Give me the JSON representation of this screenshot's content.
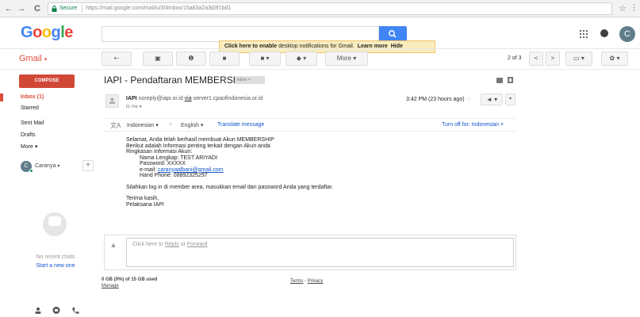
{
  "browser": {
    "back": "←",
    "forward": "→",
    "reload": "C",
    "secure_label": "Secure",
    "url": "https://mail.google.com/mail/u/3/#inbox/15a83a2a3d3f1bd1",
    "star": "☆",
    "menu": "⋮"
  },
  "header": {
    "logo_letters": [
      "G",
      "o",
      "o",
      "g",
      "l",
      "e"
    ],
    "notice_link": "Click here to enable",
    "notice_text": " desktop notifications for Gmail.",
    "notice_learn": "Learn more",
    "notice_hide": "Hide",
    "avatar_letter": "C"
  },
  "gmail_label": "Gmail",
  "gmail_caret": "▾",
  "toolbar": {
    "back": "⇠",
    "archive": "▣",
    "spam": "❶",
    "delete": "■",
    "move": "■ ▾",
    "labels": "◆ ▾",
    "more": "More ▾",
    "pager": "2 of 3",
    "prev": "<",
    "next": ">",
    "view": "▭ ▾",
    "settings": "✿ ▾"
  },
  "sidebar": {
    "compose": "COMPOSE",
    "items": [
      {
        "label": "Inbox (1)"
      },
      {
        "label": "Starred"
      },
      {
        "label": "Sent Mail"
      },
      {
        "label": "Drafts"
      },
      {
        "label": "More ▾"
      }
    ],
    "chat_user": "Caranya",
    "chat_user_caret": "▾",
    "chat_initial": "C",
    "chat_add": "+",
    "no_chats": "No recent chats",
    "start_new": "Start a new one"
  },
  "message": {
    "subject": "IAPI - Pendaftaran MEMBERSHIP",
    "label_chip": "Inbox ×",
    "sender_name": "IAPI",
    "sender_addr": "noreply@iapi.or.id",
    "via_word": "via",
    "via_server": "server1.cpaofindonesia.or.id",
    "to_me": "to me ▾",
    "time": "3:42 PM (23 hours ago)",
    "star": "☆",
    "reply": "◄ ▾",
    "more": "▾"
  },
  "translate": {
    "from_lang": "Indonesian ▾",
    "arrow": ">",
    "to_lang": "English ▾",
    "translate_link": "Translate message",
    "turn_off": "Turn off for: Indonesian ×"
  },
  "body_lines": {
    "l1": "Selamat, Anda telah berhasil membuat Akun MEMBERSHIP",
    "l2": "Berikut adalah Informasi penting terkait dengan Akun anda",
    "l3": "Ringkasan Informasi Akun:",
    "l4": "Nama Lengkap: TEST ARIYADI",
    "l5": "Password: XXXXX",
    "l6_label": "e-mail: ",
    "l6_email": "caranyaalbani@gmail.com",
    "l7": "Hand Phone: 08892325297",
    "l8": "Silahkan log in di member area, masukkan email dan password Anda yang terdaftar.",
    "l9": "Terima kasih,",
    "l10": "Pelaksana IAPI"
  },
  "reply_box": {
    "prefix": "Click here to ",
    "reply": "Reply",
    "or": " or ",
    "forward": "Forward"
  },
  "footer": {
    "storage": "0 GB (0%) of 15 GB used",
    "manage": "Manage",
    "terms": "Terms",
    "sep": " - ",
    "privacy": "Privacy"
  }
}
